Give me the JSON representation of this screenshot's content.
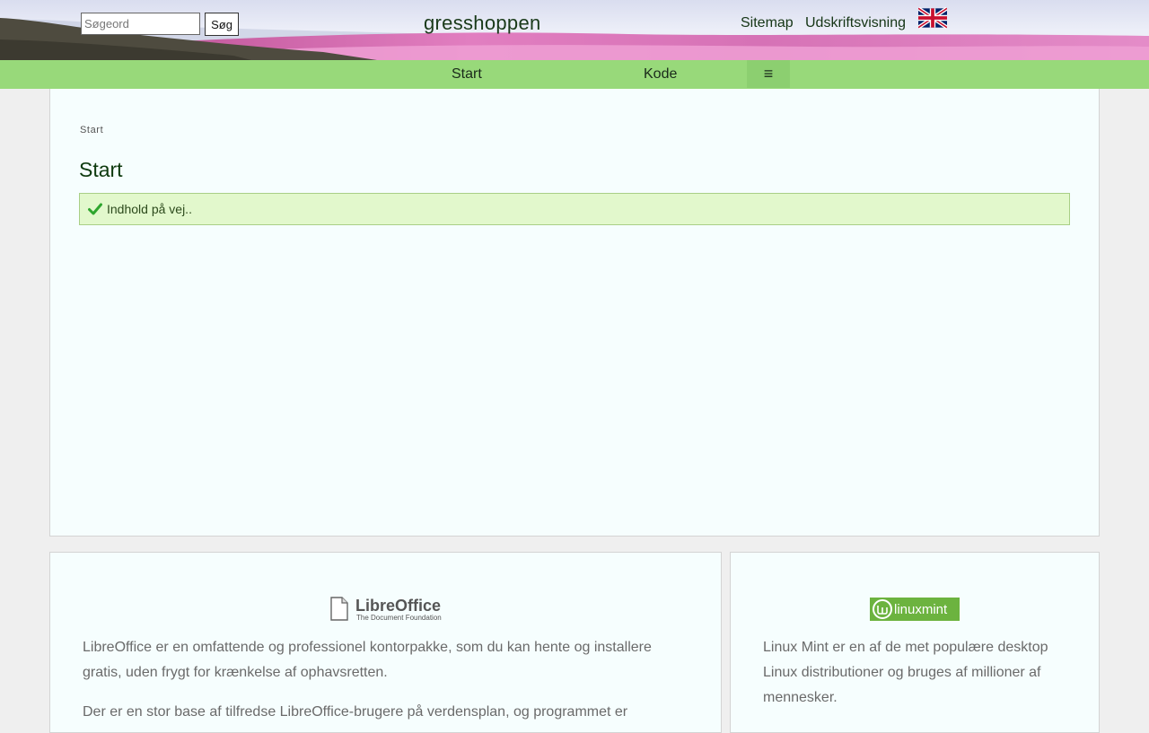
{
  "header": {
    "search": {
      "placeholder": "Søgeord",
      "value": "",
      "button_label": "Søg"
    },
    "site_title": "gresshoppen",
    "links": {
      "sitemap": "Sitemap",
      "print_view": "Udskriftsvisning"
    },
    "language_flag": "uk-flag-icon"
  },
  "nav": {
    "items": [
      {
        "label": "Start"
      },
      {
        "label": "Kode"
      }
    ],
    "menu_label": "≡",
    "color": "#98d97a"
  },
  "main": {
    "breadcrumb": "Start",
    "title": "Start",
    "status": {
      "icon": "check-icon",
      "text": "Indhold på vej..",
      "bg": "#e2f8cc"
    }
  },
  "cards": {
    "libreoffice": {
      "logo_text": "LibreOffice",
      "logo_subtext": "The Document Foundation",
      "paragraphs": [
        "LibreOffice er en omfattende og professionel kontorpakke, som du kan hente og installere gratis, uden frygt for krænkelse af ophavsretten.",
        "Der er en stor base af tilfredse LibreOffice-brugere på verdensplan, og programmet er"
      ]
    },
    "linuxmint": {
      "logo_text": "linuxmint",
      "paragraphs": [
        "Linux Mint er en af de met populære desktop Linux distributioner og bruges af millioner af mennesker."
      ]
    }
  }
}
